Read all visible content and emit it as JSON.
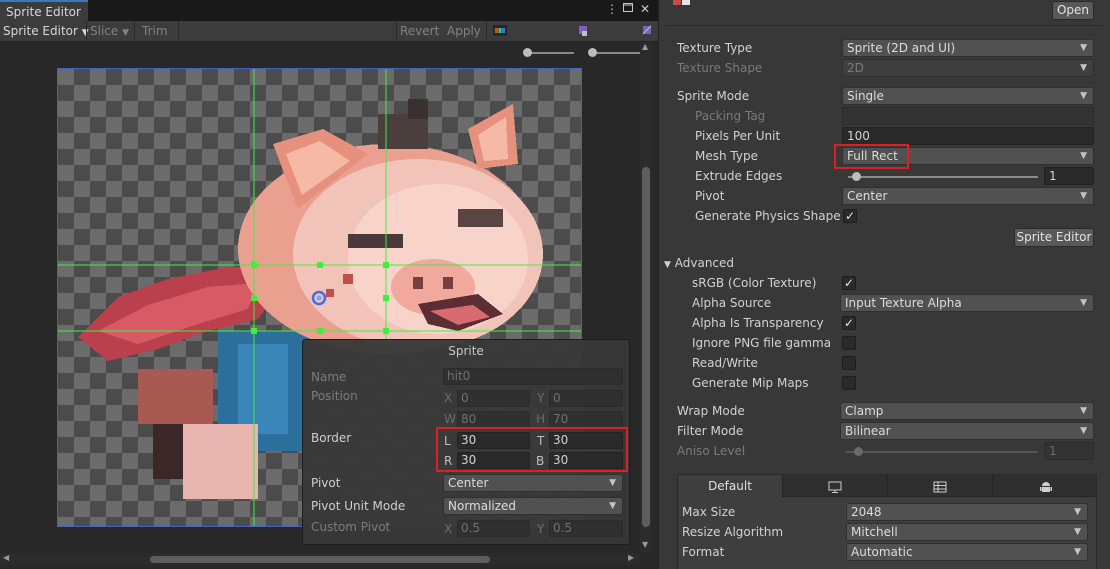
{
  "window": {
    "tab_title": "Sprite Editor"
  },
  "toolbar": {
    "mode_label": "Sprite Editor",
    "slice_label": "Slice",
    "trim_label": "Trim",
    "revert_label": "Revert",
    "apply_label": "Apply"
  },
  "sprite_panel": {
    "title": "Sprite",
    "name_label": "Name",
    "name_value": "hit0",
    "position_label": "Position",
    "pos_x": "0",
    "pos_y": "0",
    "pos_w": "80",
    "pos_h": "70",
    "border_label": "Border",
    "border_l": "30",
    "border_t": "30",
    "border_r": "30",
    "border_b": "30",
    "pivot_label": "Pivot",
    "pivot_value": "Center",
    "pivot_unit_label": "Pivot Unit Mode",
    "pivot_unit_value": "Normalized",
    "custom_pivot_label": "Custom Pivot",
    "custom_x": "0.5",
    "custom_y": "0.5",
    "axis": {
      "x": "X",
      "y": "Y",
      "w": "W",
      "h": "H",
      "l": "L",
      "t": "T",
      "r": "R",
      "b": "B"
    }
  },
  "inspector": {
    "open_button": "Open",
    "texture_type_label": "Texture Type",
    "texture_type_value": "Sprite (2D and UI)",
    "texture_shape_label": "Texture Shape",
    "texture_shape_value": "2D",
    "sprite_mode_label": "Sprite Mode",
    "sprite_mode_value": "Single",
    "packing_tag_label": "Packing Tag",
    "pixels_per_unit_label": "Pixels Per Unit",
    "pixels_per_unit_value": "100",
    "mesh_type_label": "Mesh Type",
    "mesh_type_value": "Full Rect",
    "extrude_edges_label": "Extrude Edges",
    "extrude_edges_value": "1",
    "pivot_label": "Pivot",
    "pivot_value": "Center",
    "physics_shape_label": "Generate Physics Shape",
    "sprite_editor_button": "Sprite Editor",
    "advanced_label": "Advanced",
    "srgb_label": "sRGB (Color Texture)",
    "alpha_source_label": "Alpha Source",
    "alpha_source_value": "Input Texture Alpha",
    "alpha_transparency_label": "Alpha Is Transparency",
    "ignore_png_gamma_label": "Ignore PNG file gamma",
    "read_write_label": "Read/Write",
    "mip_maps_label": "Generate Mip Maps",
    "wrap_mode_label": "Wrap Mode",
    "wrap_mode_value": "Clamp",
    "filter_mode_label": "Filter Mode",
    "filter_mode_value": "Bilinear",
    "aniso_level_label": "Aniso Level",
    "aniso_level_value": "1",
    "platform_default_tab": "Default",
    "max_size_label": "Max Size",
    "max_size_value": "2048",
    "resize_algorithm_label": "Resize Algorithm",
    "resize_algorithm_value": "Mitchell",
    "format_label": "Format",
    "format_value": "Automatic"
  },
  "checkmark": "✓",
  "colors": {
    "accent_blue": "#3a79bb",
    "highlight_red": "#e02020",
    "guide_green": "#3cf03c",
    "sprite_rect_blue": "#3f62c4"
  }
}
